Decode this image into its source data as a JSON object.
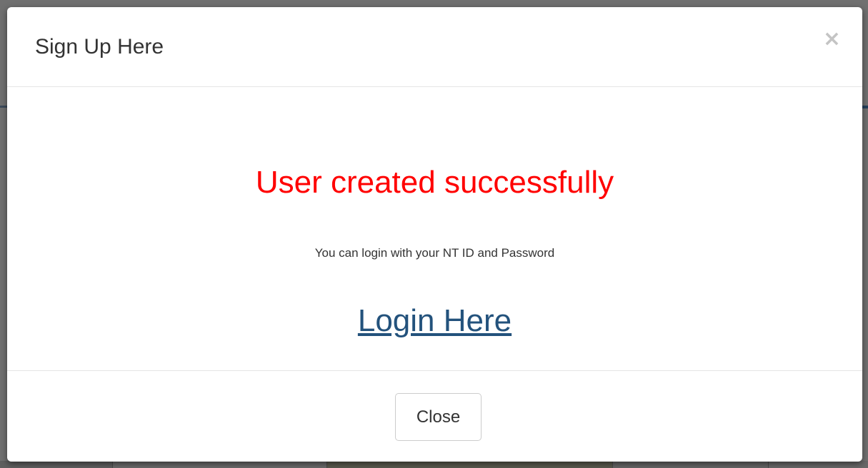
{
  "modal": {
    "title": "Sign Up Here",
    "close_icon": "×",
    "success_message": "User created successfully",
    "info_text": "You can login with your NT ID and Password",
    "login_link": "Login Here",
    "close_button": "Close"
  },
  "colors": {
    "success": "#ff0000",
    "link": "#23527c",
    "text": "#333333"
  }
}
